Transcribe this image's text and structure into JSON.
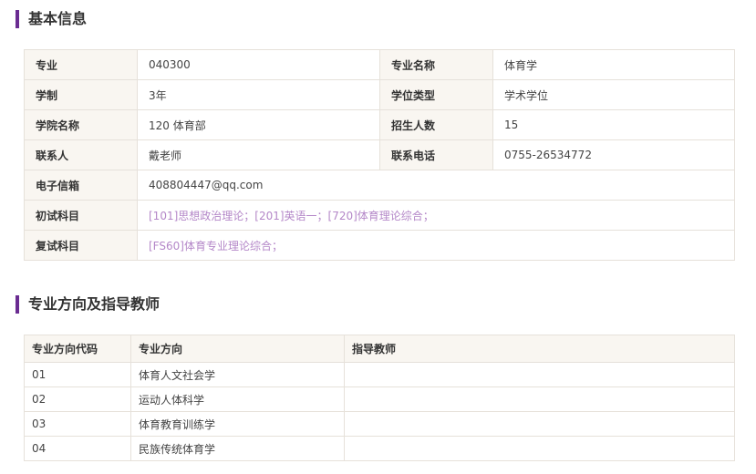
{
  "basic_info": {
    "title": "基本信息",
    "rows": [
      [
        {
          "label": "专业",
          "value": "040300"
        },
        {
          "label": "专业名称",
          "value": "体育学"
        }
      ],
      [
        {
          "label": "学制",
          "value": "3年"
        },
        {
          "label": "学位类型",
          "value": "学术学位"
        }
      ],
      [
        {
          "label": "学院名称",
          "value": "120 体育部"
        },
        {
          "label": "招生人数",
          "value": "15"
        }
      ],
      [
        {
          "label": "联系人",
          "value": "戴老师"
        },
        {
          "label": "联系电话",
          "value": "0755-26534772"
        }
      ]
    ],
    "email": {
      "label": "电子信箱",
      "value": "408804447@qq.com"
    },
    "first_exam": {
      "label": "初试科目",
      "value": "[101]思想政治理论；[201]英语一；[720]体育理论综合；"
    },
    "second_exam": {
      "label": "复试科目",
      "value": "[FS60]体育专业理论综合；"
    }
  },
  "directions": {
    "title": "专业方向及指导教师",
    "headers": [
      "专业方向代码",
      "专业方向",
      "指导教师"
    ],
    "rows": [
      [
        "01",
        "体育人文社会学",
        ""
      ],
      [
        "02",
        "运动人体科学",
        ""
      ],
      [
        "03",
        "体育教育训练学",
        ""
      ],
      [
        "04",
        "民族传统体育学",
        ""
      ]
    ]
  },
  "colors": {
    "accent": "#6a2c91",
    "link": "#b487c8",
    "label_bg": "#f9f6f1",
    "border": "#e6e1da"
  }
}
